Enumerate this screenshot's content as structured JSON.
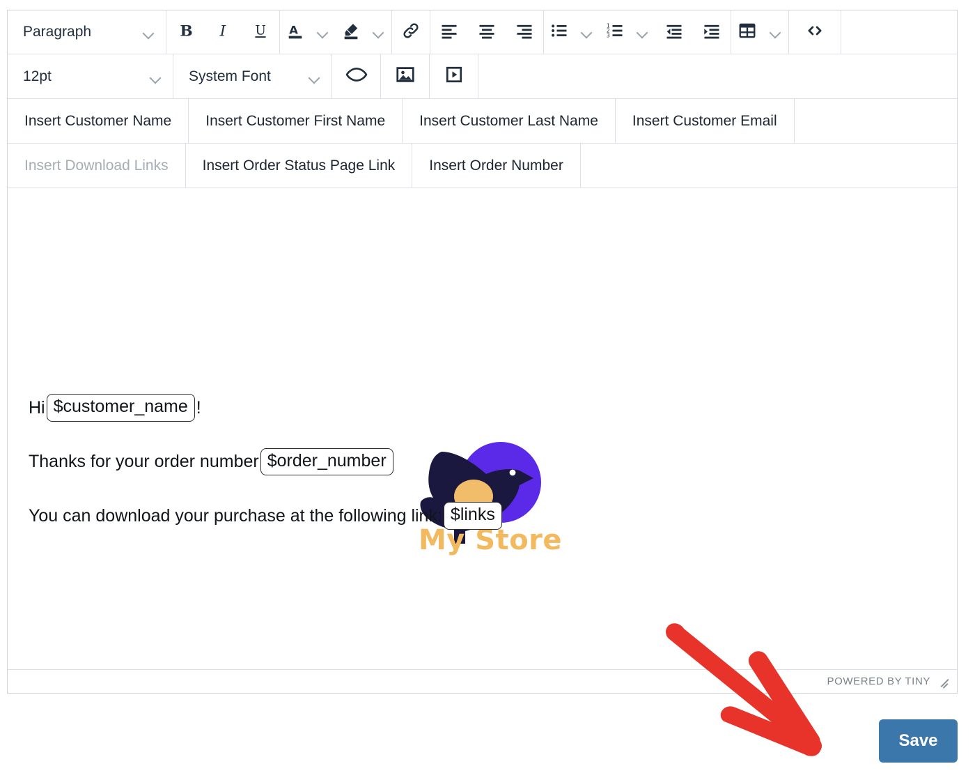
{
  "editor": {
    "toolbar_row1": {
      "block_format": {
        "label": "Paragraph",
        "icon": "chevron-down-icon"
      },
      "bold": {
        "icon": "bold-icon",
        "label": "B"
      },
      "italic": {
        "icon": "italic-icon",
        "label": "I"
      },
      "underline": {
        "icon": "underline-icon",
        "label": "U"
      },
      "text_color": {
        "icon": "text-color-icon",
        "label": "A"
      },
      "highlight_color": {
        "icon": "highlight-color-icon"
      },
      "link": {
        "icon": "link-icon"
      },
      "align_left": {
        "icon": "align-left-icon"
      },
      "align_center": {
        "icon": "align-center-icon"
      },
      "align_right": {
        "icon": "align-right-icon"
      },
      "bullet_list": {
        "icon": "bulleted-list-icon"
      },
      "numbered_list": {
        "icon": "numbered-list-icon"
      },
      "outdent": {
        "icon": "decrease-indent-icon"
      },
      "indent": {
        "icon": "increase-indent-icon"
      },
      "table": {
        "icon": "table-icon"
      },
      "source_code": {
        "icon": "source-code-icon"
      }
    },
    "toolbar_row2": {
      "font_size": {
        "label": "12pt",
        "icon": "chevron-down-icon"
      },
      "font_family": {
        "label": "System Font",
        "icon": "chevron-down-icon"
      },
      "preview": {
        "icon": "eye-icon"
      },
      "insert_image": {
        "icon": "image-icon"
      },
      "insert_media": {
        "icon": "media-play-icon"
      }
    },
    "insert_row1": [
      {
        "label": "Insert Customer Name",
        "disabled": false
      },
      {
        "label": "Insert Customer First Name",
        "disabled": false
      },
      {
        "label": "Insert Customer Last Name",
        "disabled": false
      },
      {
        "label": "Insert Customer Email",
        "disabled": false
      }
    ],
    "insert_row2": [
      {
        "label": "Insert Download Links",
        "disabled": true
      },
      {
        "label": "Insert Order Status Page Link",
        "disabled": false
      },
      {
        "label": "Insert Order Number",
        "disabled": false
      }
    ],
    "content": {
      "logo": {
        "name": "my-store-logo",
        "text": "My Store",
        "circle_color": "#5b2ae8",
        "bird_color": "#1b1840",
        "belly_color": "#f2bd6a",
        "text_color": "#f2b95f"
      },
      "paragraphs": [
        {
          "before": "Hi ",
          "tag": "$customer_name",
          "after": "!"
        },
        {
          "before": "Thanks for your order number ",
          "tag": "$order_number",
          "after": ""
        },
        {
          "before": "You can download your purchase at the following link: ",
          "tag": "$links",
          "after": ""
        }
      ]
    },
    "statusbar": {
      "powered_by": "POWERED BY TINY",
      "resize_icon": "resize-handle-icon"
    }
  },
  "actions": {
    "save_label": "Save",
    "save_color": "#3b77ab"
  },
  "annotation": {
    "arrow": {
      "name": "red-arrow-annotation",
      "color": "#e8332a"
    }
  }
}
